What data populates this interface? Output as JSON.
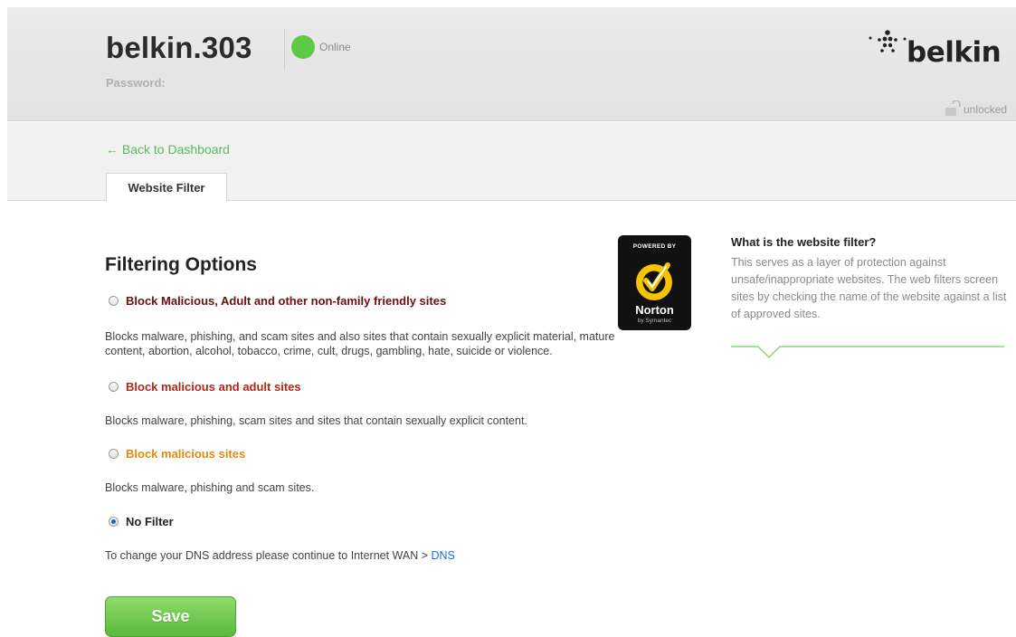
{
  "header": {
    "device_name": "belkin.303",
    "status_text": "Online",
    "status_color": "#5ec943",
    "password_label": "Password:",
    "logo_text": "belkin",
    "lock_text": "unlocked",
    "lock_icon": "unlocked-padlock-icon"
  },
  "nav": {
    "back_link": "← Back to Dashboard",
    "tab_label": "Website Filter"
  },
  "main": {
    "title": "Filtering Options",
    "badge": {
      "top_text": "POWERED BY",
      "brand": "Norton",
      "sub": "by Symantec"
    },
    "options": [
      {
        "label": "Block Malicious, Adult and other non-family friendly sites",
        "color": "#6b1010",
        "checked": false,
        "description": "Blocks malware, phishing, and scam sites and also sites that contain sexually explicit material, mature content, abortion, alcohol, tobacco, crime, cult, drugs, gambling, hate, suicide or violence."
      },
      {
        "label": "Block malicious and adult sites",
        "color": "#b0281a",
        "checked": false,
        "description": "Blocks malware, phishing, scam sites and sites that contain sexually explicit content."
      },
      {
        "label": "Block malicious sites",
        "color": "#e08a10",
        "checked": false,
        "description": "Blocks malware, phishing and scam sites."
      },
      {
        "label": "No Filter",
        "color": "#222222",
        "checked": true,
        "description": ""
      }
    ],
    "dns_text": "To change your DNS address please continue to Internet WAN > ",
    "dns_link": "DNS",
    "save_label": "Save"
  },
  "sidebar": {
    "title": "What is the website filter?",
    "body": "This serves as a layer of protection against unsafe/inappropriate websites. The web filters screen sites by checking the name of the website against a list of approved sites."
  },
  "colors": {
    "accent_green": "#5cb85c",
    "link_blue": "#1a6fd6"
  }
}
